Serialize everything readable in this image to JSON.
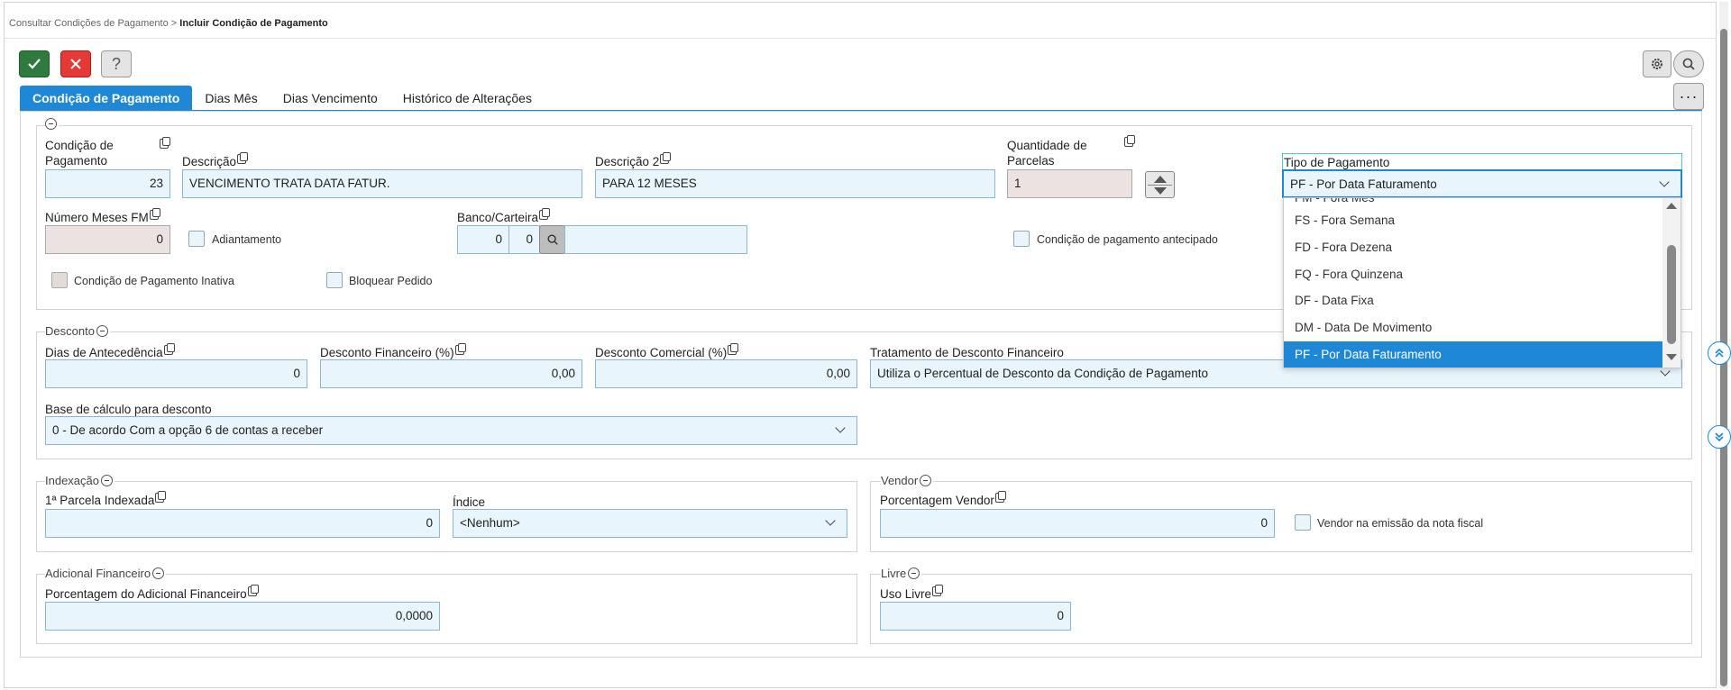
{
  "breadcrumb": {
    "parent": "Consultar Condições de Pagamento",
    "separator": ">",
    "current": "Incluir Condição de Pagamento"
  },
  "toolbar": {
    "help_label": "?"
  },
  "tabs": [
    "Condição de Pagamento",
    "Dias Mês",
    "Dias Vencimento",
    "Histórico de Alterações"
  ],
  "main": {
    "condicao_label_1": "Condição de",
    "condicao_label_2": "Pagamento",
    "condicao_value": "23",
    "descricao_label": "Descrição",
    "descricao_value": "VENCIMENTO TRATA DATA FATUR.",
    "descricao2_label": "Descrição 2",
    "descricao2_value": "PARA 12 MESES",
    "qtd_label_1": "Quantidade de",
    "qtd_label_2": "Parcelas",
    "qtd_value": "1",
    "tipo_label": "Tipo de Pagamento",
    "tipo_value": "PF - Por Data Faturamento",
    "meses_label": "Número Meses FM",
    "meses_value": "0",
    "adiantamento_label": "Adiantamento",
    "banco_label": "Banco/Carteira",
    "banco_value": "0",
    "carteira_value": "0",
    "antecipado_label": "Condição de pagamento antecipado",
    "inativa_label": "Condição de Pagamento Inativa",
    "bloquear_label": "Bloquear Pedido"
  },
  "tipo_options": [
    {
      "label": "FM - Fora Mês",
      "selected": false
    },
    {
      "label": "FS - Fora Semana",
      "selected": false
    },
    {
      "label": "FD - Fora Dezena",
      "selected": false
    },
    {
      "label": "FQ - Fora Quinzena",
      "selected": false
    },
    {
      "label": "DF - Data Fixa",
      "selected": false
    },
    {
      "label": "DM - Data De Movimento",
      "selected": false
    },
    {
      "label": "PF - Por Data Faturamento",
      "selected": true
    }
  ],
  "desconto": {
    "title": "Desconto",
    "antecedencia_label": "Dias de Antecedência",
    "antecedencia_value": "0",
    "financeiro_label": "Desconto Financeiro (%)",
    "financeiro_value": "0,00",
    "comercial_label": "Desconto Comercial (%)",
    "comercial_value": "0,00",
    "tratamento_label": "Tratamento de Desconto Financeiro",
    "tratamento_value": "Utiliza o Percentual de Desconto da Condição de Pagamento",
    "base_label": "Base de cálculo para desconto",
    "base_value": "0 - De acordo Com a opção 6 de contas a receber"
  },
  "indexacao": {
    "title": "Indexação",
    "parcela_label": "1ª Parcela Indexada",
    "parcela_value": "0",
    "indice_label": "Índice",
    "indice_value": "<Nenhum>"
  },
  "vendor": {
    "title": "Vendor",
    "porcentagem_label": "Porcentagem Vendor",
    "porcentagem_value": "0",
    "emissao_label": "Vendor na emissão da nota fiscal"
  },
  "adicional": {
    "title": "Adicional Financeiro",
    "porcentagem_label": "Porcentagem do Adicional Financeiro",
    "porcentagem_value": "0,0000"
  },
  "livre": {
    "title": "Livre",
    "uso_label": "Uso Livre",
    "uso_value": "0"
  },
  "colors": {
    "accent": "#1e88d6",
    "ok": "#2f7a3f",
    "cancel": "#e53935",
    "input_bg": "#e8f5fc",
    "disabled_bg": "#ede2e2"
  },
  "icons": [
    "check-icon",
    "close-icon",
    "help-icon",
    "gear-icon",
    "search-icon",
    "more-icon",
    "copy-icon",
    "collapse-icon",
    "spinner-icon",
    "chevron-down-icon",
    "chevrons-up-icon",
    "chevrons-down-icon"
  ]
}
